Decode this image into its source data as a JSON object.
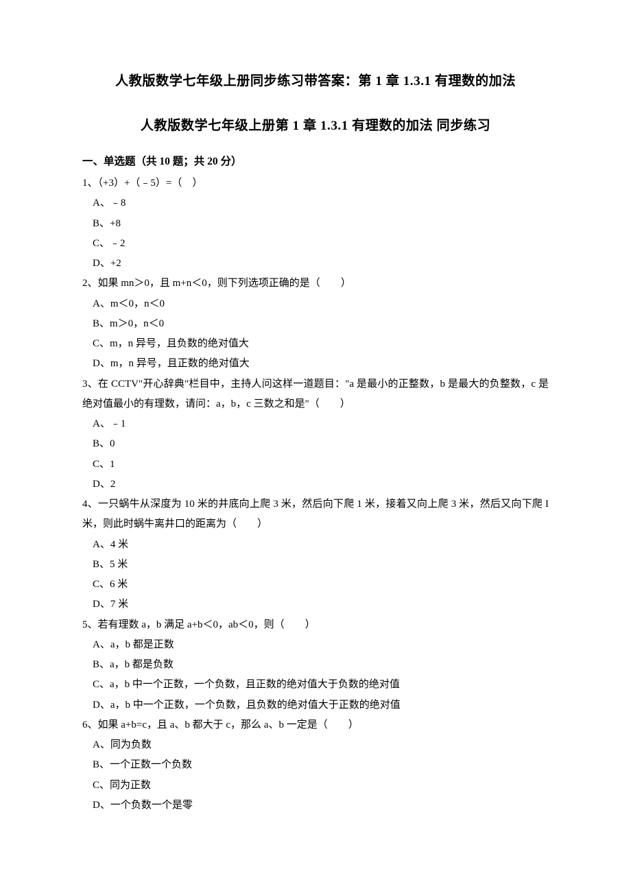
{
  "titles": {
    "main": "人教版数学七年级上册同步练习带答案：第 1 章 1.3.1 有理数的加法",
    "sub": "人教版数学七年级上册第 1 章  1.3.1 有理数的加法  同步练习"
  },
  "section1": {
    "header": "一、单选题（共 10 题；共 20 分）"
  },
  "q1": {
    "stem": "1、（+3）+（﹣5）=（　）",
    "a": "A、﹣8",
    "b": "B、+8",
    "c": "C、﹣2",
    "d": "D、+2"
  },
  "q2": {
    "stem": "2、如果 mn＞0，且 m+n＜0，则下列选项正确的是（　　）",
    "a": "A、m＜0，n＜0",
    "b": "B、m＞0，n＜0",
    "c": "C、m，n 异号，且负数的绝对值大",
    "d": "D、m，n 异号，且正数的绝对值大"
  },
  "q3": {
    "stem": "3、在 CCTV\"开心辞典\"栏目中，主持人问这样一道题目：\"a 是最小的正整数，b 是最大的负整数，c 是绝对值最小的有理数，请问：a，b，c 三数之和是\"（　　）",
    "a": "A、﹣1",
    "b": "B、0",
    "c": "C、1",
    "d": "D、2"
  },
  "q4": {
    "stem": "4、一只蜗牛从深度为 10 米的井底向上爬 3 米，然后向下爬 1 米，接着又向上爬 3 米，然后又向下爬 I 米，则此时蜗牛离井口的距离为（　　）",
    "a": "A、4 米",
    "b": "B、5 米",
    "c": "C、6 米",
    "d": "D、7 米"
  },
  "q5": {
    "stem": "5、若有理数 a，b 满足 a+b＜0，ab＜0，则（　　）",
    "a": "A、a，b 都是正数",
    "b": "B、a，b 都是负数",
    "c": "C、a，b 中一个正数，一个负数，且正数的绝对值大于负数的绝对值",
    "d": "D、a，b 中一个正数，一个负数，且负数的绝对值大于正数的绝对值"
  },
  "q6": {
    "stem": "6、如果 a+b=c，且 a、b 都大于 c，那么 a、b 一定是（　　）",
    "a": "A、同为负数",
    "b": "B、一个正数一个负数",
    "c": "C、同为正数",
    "d": "D、一个负数一个是零"
  }
}
